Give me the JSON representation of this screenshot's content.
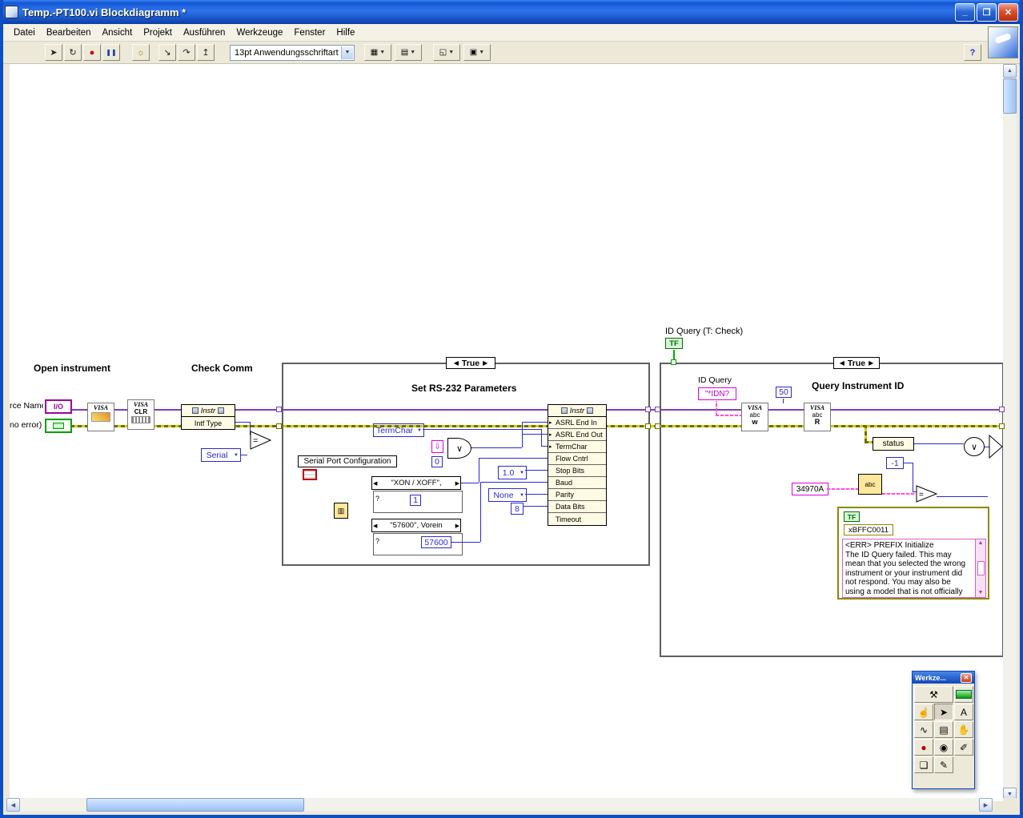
{
  "window": {
    "title": "Temp.-PT100.vi Blockdiagramm *",
    "buttons": {
      "minimize": "_",
      "maximize": "❐",
      "close": "✕"
    }
  },
  "menu": {
    "items": [
      "Datei",
      "Bearbeiten",
      "Ansicht",
      "Projekt",
      "Ausführen",
      "Werkzeuge",
      "Fenster",
      "Hilfe"
    ]
  },
  "toolbar": {
    "font": "13pt Anwendungsschriftart",
    "icons": {
      "run": "➤",
      "run_continuous": "↻",
      "abort": "●",
      "pause": "❚❚",
      "highlight": "☼",
      "step_into": "↘",
      "step_over": "↷",
      "step_out": "↥",
      "align": "▦",
      "distribute": "▤",
      "resize": "◱",
      "reorder": "▣",
      "help": "?"
    }
  },
  "scroll": {
    "up": "▲",
    "down": "▼",
    "left": "◀",
    "right": "▶"
  },
  "diagram": {
    "labels": {
      "open_instrument": "Open instrument",
      "check_comm": "Check Comm",
      "resource_name": "rce Name",
      "no_error": "no error)",
      "id_query_check": "ID Query (T: Check)",
      "set_rs232": "Set RS-232 Parameters",
      "serial_port_config": "Serial Port Configuration",
      "query_instrument_id": "Query Instrument ID",
      "id_query": "ID Query"
    },
    "case_selector": "True",
    "io_terminal": "I/O",
    "prop1": {
      "header": "Instr",
      "row": "Intf Type"
    },
    "rings": {
      "serial": "Serial",
      "termchar": "TermChar",
      "one_decimal": "1.0",
      "none": "None",
      "xon": "\"XON / XOFF\",",
      "baud": "\"57600\", Vorein"
    },
    "consts": {
      "zero": "0",
      "one": "1",
      "eight": "8",
      "baud": "57600",
      "fifty": "50",
      "minus_one": "-1",
      "tf": "TF",
      "idn": "\"*IDN?",
      "model": "34970A",
      "eq": "=",
      "q": "?",
      "down": "⇩",
      "or": "∨"
    },
    "visa": {
      "brand": "VISA",
      "clr": "CLR",
      "abc": "abc",
      "w": "w",
      "r": "R"
    },
    "prop2": {
      "header": "Instr",
      "rows": [
        "ASRL End In",
        "ASRL End Out",
        "TermChar",
        "Flow Cntrl",
        "Stop Bits",
        "Baud",
        "Parity",
        "Data Bits",
        "Timeout"
      ]
    },
    "unbundle": {
      "status": "status"
    },
    "error_cluster": {
      "code": "xBFFC0011",
      "message": "<ERR> PREFIX Initialize\nThe ID Query failed.  This may\nmean that you selected the wrong\ninstrument or your instrument did\nnot respond.  You may also be\nusing a model that is not officially"
    }
  },
  "palette": {
    "title": "Werkze...",
    "close": "✕",
    "glyphs": [
      "⚒",
      "☝",
      "➤",
      "A",
      "∿",
      "▤",
      "✋",
      "●",
      "◉",
      "✐",
      "❏",
      "✎"
    ]
  }
}
